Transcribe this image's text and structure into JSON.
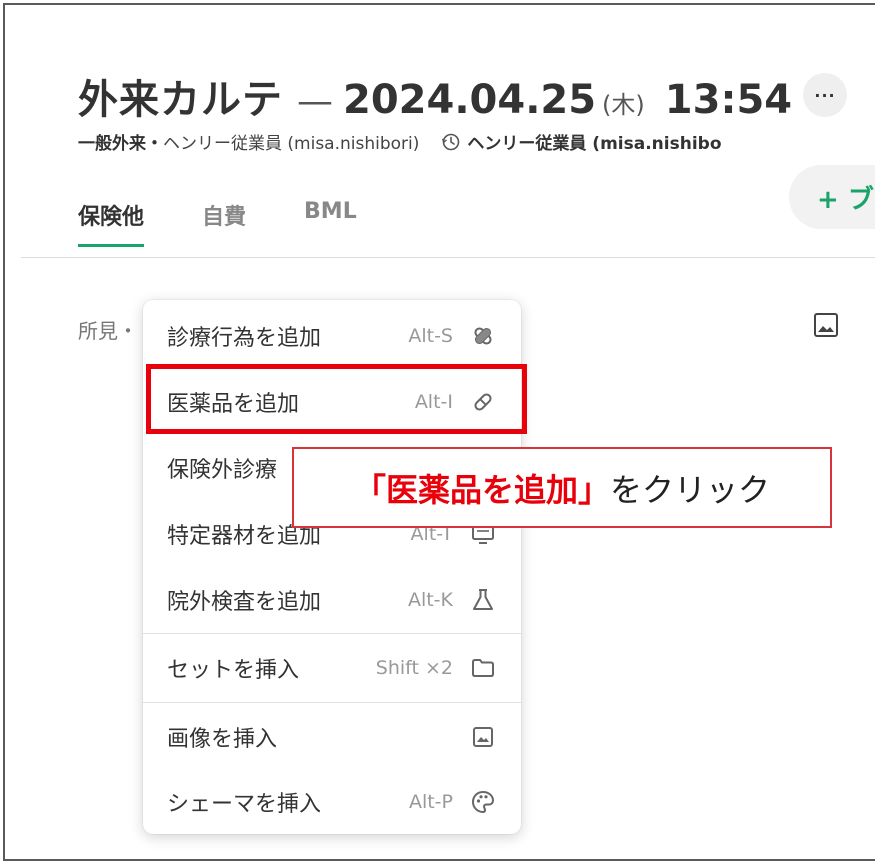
{
  "header": {
    "title": "外来カルテ",
    "dash": "—",
    "date": "2024.04.25",
    "day_of_week": "(木)",
    "time": "13:54",
    "more_label": "···",
    "subtitle_left_bold": "一般外来・",
    "subtitle_left_user": "ヘンリー従業員 (misa.nishibori)",
    "subtitle_right": "ヘンリー従業員 (misa.nishibo",
    "add_button_label": "+ ブ"
  },
  "tabs": [
    {
      "label": "保険他",
      "active": true
    },
    {
      "label": "自費",
      "active": false
    },
    {
      "label": "BML",
      "active": false
    }
  ],
  "content": {
    "section_label": "所見・"
  },
  "menu": {
    "items": [
      {
        "label": "診療行為を追加",
        "shortcut": "Alt-S",
        "icon": "bandage-icon"
      },
      {
        "label": "医薬品を追加",
        "shortcut": "Alt-I",
        "icon": "pill-icon"
      },
      {
        "label": "保険外診療",
        "shortcut": "",
        "icon": ""
      },
      {
        "label": "特定器材を追加",
        "shortcut": "Alt-T",
        "icon": "equipment-icon"
      },
      {
        "label": "院外検査を追加",
        "shortcut": "Alt-K",
        "icon": "flask-icon"
      },
      {
        "label": "セットを挿入",
        "shortcut": "Shift ×2",
        "icon": "folder-icon"
      },
      {
        "label": "画像を挿入",
        "shortcut": "",
        "icon": "image-icon"
      },
      {
        "label": "シェーマを挿入",
        "shortcut": "Alt-P",
        "icon": "palette-icon"
      }
    ]
  },
  "callout": {
    "emphasis": "「医薬品を追加」",
    "rest": "をクリック"
  },
  "colors": {
    "accent_green": "#1aa36b",
    "highlight_red": "#e8000b"
  }
}
